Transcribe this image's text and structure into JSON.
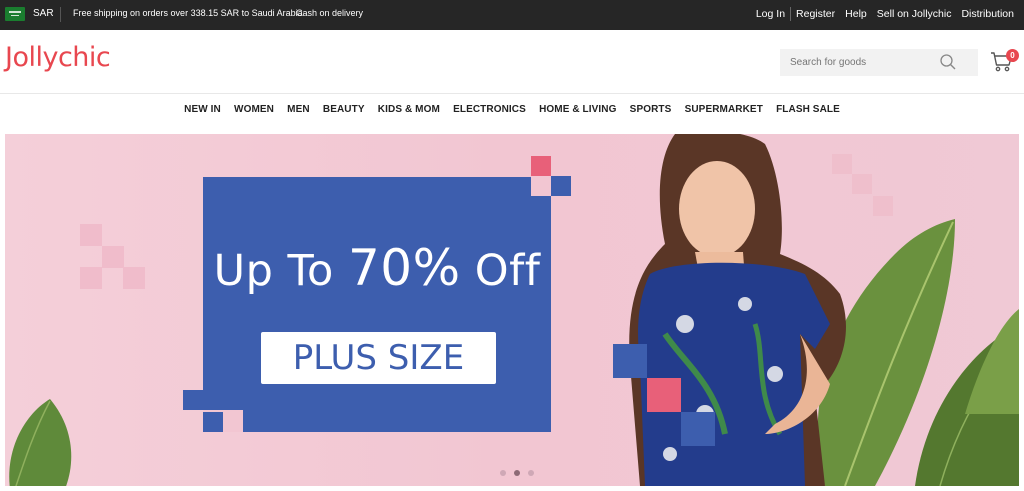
{
  "topbar": {
    "currency": "SAR",
    "shipping_notice": "Free shipping on orders over 338.15 SAR to Saudi Arabia",
    "cod_notice": "Cash on delivery",
    "links": [
      "Log In",
      "Register",
      "Help",
      "Sell on Jollychic",
      "Distribution"
    ]
  },
  "header": {
    "logo": "Jollychic",
    "search_placeholder": "Search for goods",
    "cart_count": "0"
  },
  "nav": {
    "items": [
      "NEW IN",
      "WOMEN",
      "MEN",
      "BEAUTY",
      "KIDS & MOM",
      "ELECTRONICS",
      "HOME & LIVING",
      "SPORTS",
      "SUPERMARKET",
      "FLASH SALE"
    ]
  },
  "banner": {
    "headline_prefix": "Up To ",
    "headline_number": "70%",
    "headline_suffix": " Off",
    "tag": "PLUS SIZE",
    "slides": 3,
    "active_slide": 2
  },
  "colors": {
    "brand": "#e8474f",
    "promo_blue": "#3d5eae",
    "banner_pink": "#f2c6d2"
  }
}
